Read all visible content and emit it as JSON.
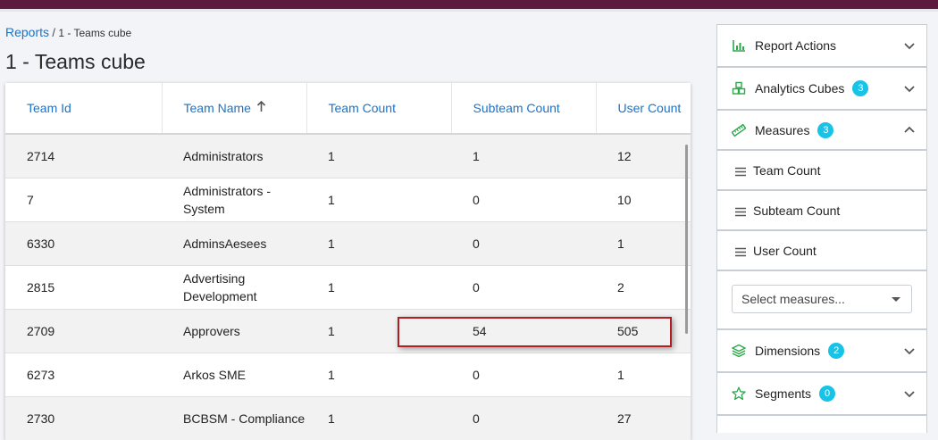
{
  "breadcrumb": {
    "root": "Reports",
    "separator": "/",
    "current": "1 - Teams cube"
  },
  "page_title": "1 - Teams cube",
  "table": {
    "columns": [
      "Team Id",
      "Team Name",
      "Team Count",
      "Subteam Count",
      "User Count"
    ],
    "sorted_column": "Team Name",
    "sort_direction": "ascending",
    "rows": [
      [
        "2714",
        "Administrators",
        "1",
        "1",
        "12"
      ],
      [
        "7",
        "Administrators - System",
        "1",
        "0",
        "10"
      ],
      [
        "6330",
        "AdminsAesees",
        "1",
        "0",
        "1"
      ],
      [
        "2815",
        "Advertising Development",
        "1",
        "0",
        "2"
      ],
      [
        "2709",
        "Approvers",
        "1",
        "54",
        "505"
      ],
      [
        "6273",
        "Arkos SME",
        "1",
        "0",
        "1"
      ],
      [
        "2730",
        "BCBSM - Compliance",
        "1",
        "0",
        "27"
      ]
    ]
  },
  "panel": {
    "report_actions": {
      "label": "Report Actions",
      "icon": "bar-chart-icon"
    },
    "analytics_cubes": {
      "label": "Analytics Cubes",
      "badge": "3",
      "icon": "cubes-icon"
    },
    "measures": {
      "label": "Measures",
      "badge": "3",
      "icon": "ruler-icon",
      "items": [
        "Team Count",
        "Subteam Count",
        "User Count"
      ],
      "select_placeholder": "Select measures..."
    },
    "dimensions": {
      "label": "Dimensions",
      "badge": "2",
      "icon": "layers-icon"
    },
    "segments": {
      "label": "Segments",
      "badge": "0",
      "icon": "star-icon"
    }
  },
  "colors": {
    "accent": "#1a73c8",
    "badge": "#18c3e8",
    "icon_green": "#2aa84a",
    "topbar": "#5b1a3e",
    "highlight": "#b31d24"
  }
}
